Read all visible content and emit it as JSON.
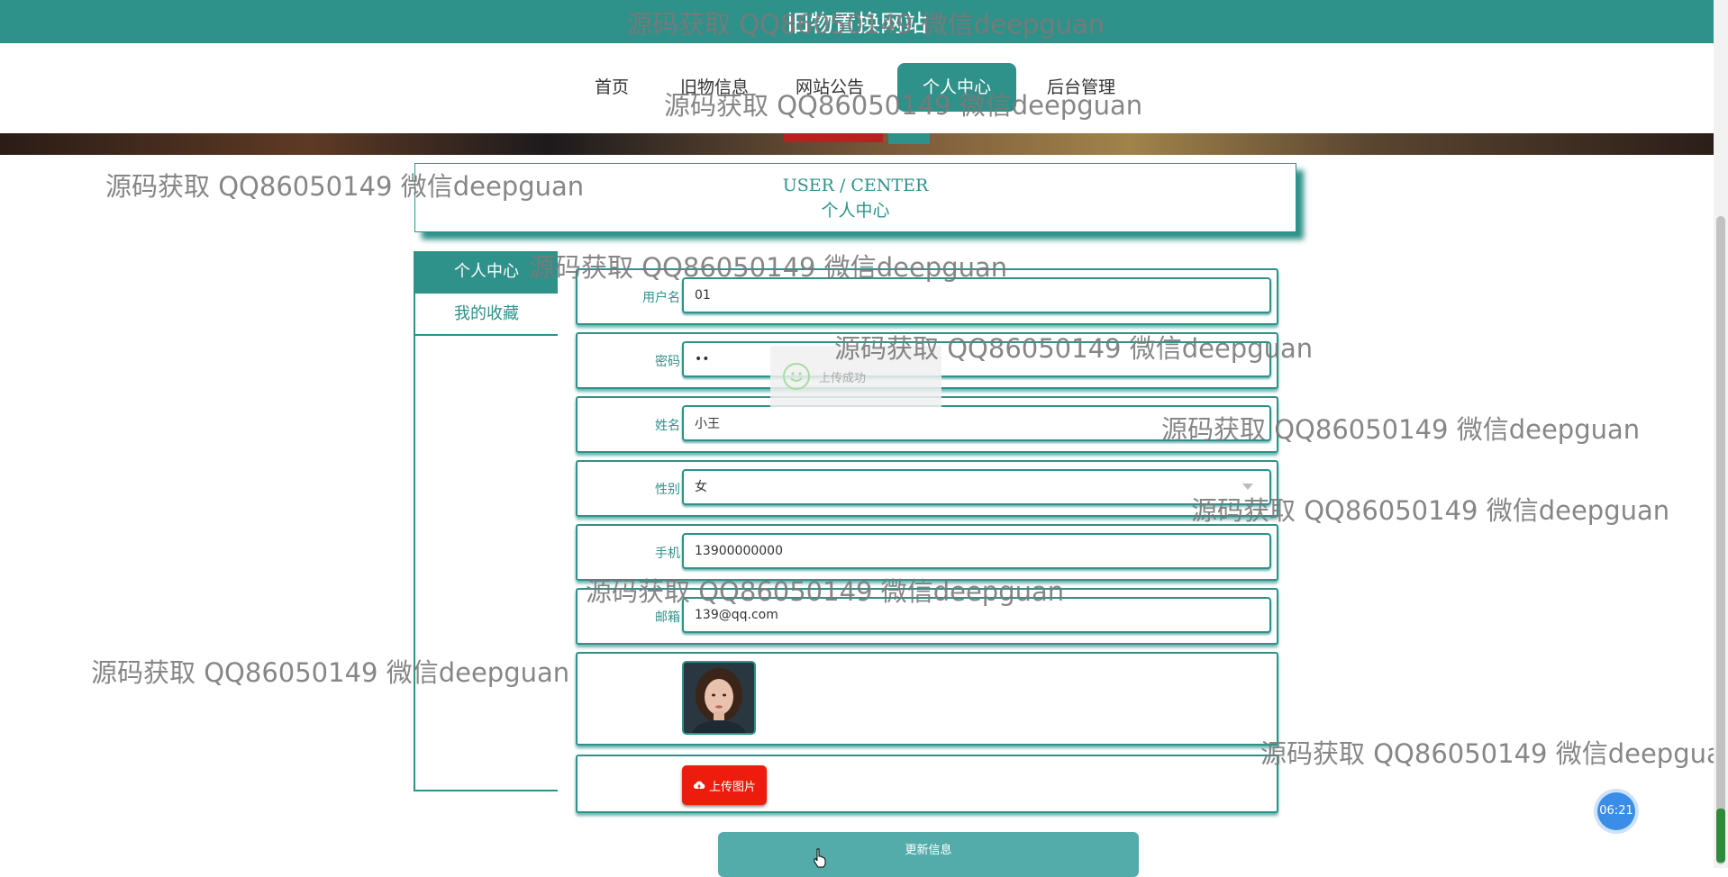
{
  "header": {
    "site_title": "旧物置换网站"
  },
  "nav": {
    "items": [
      {
        "label": "首页",
        "active": false
      },
      {
        "label": "旧物信息",
        "active": false
      },
      {
        "label": "网站公告",
        "active": false
      },
      {
        "label": "个人中心",
        "active": true
      },
      {
        "label": "后台管理",
        "active": false
      }
    ]
  },
  "user_center": {
    "title_en": "USER / CENTER",
    "title_cn": "个人中心"
  },
  "sidebar": {
    "items": [
      {
        "label": "个人中心",
        "active": true
      },
      {
        "label": "我的收藏",
        "active": false
      }
    ]
  },
  "form": {
    "username": {
      "label": "用户名",
      "value": "01"
    },
    "password": {
      "label": "密码",
      "value": "••"
    },
    "name": {
      "label": "姓名",
      "value": "小王"
    },
    "gender": {
      "label": "性别",
      "value": "女"
    },
    "phone": {
      "label": "手机",
      "value": "13900000000"
    },
    "email": {
      "label": "邮箱",
      "value": "139@qq.com"
    },
    "upload_label": "上传图片",
    "submit_label": "更新信息"
  },
  "toast": {
    "message": "上传成功"
  },
  "timer": {
    "value": "06:21"
  },
  "watermark": "源码获取 QQ86050149 微信deepguan",
  "colors": {
    "primary": "#2e918a",
    "upload": "#ee1c0c",
    "submit": "#54acaa"
  }
}
